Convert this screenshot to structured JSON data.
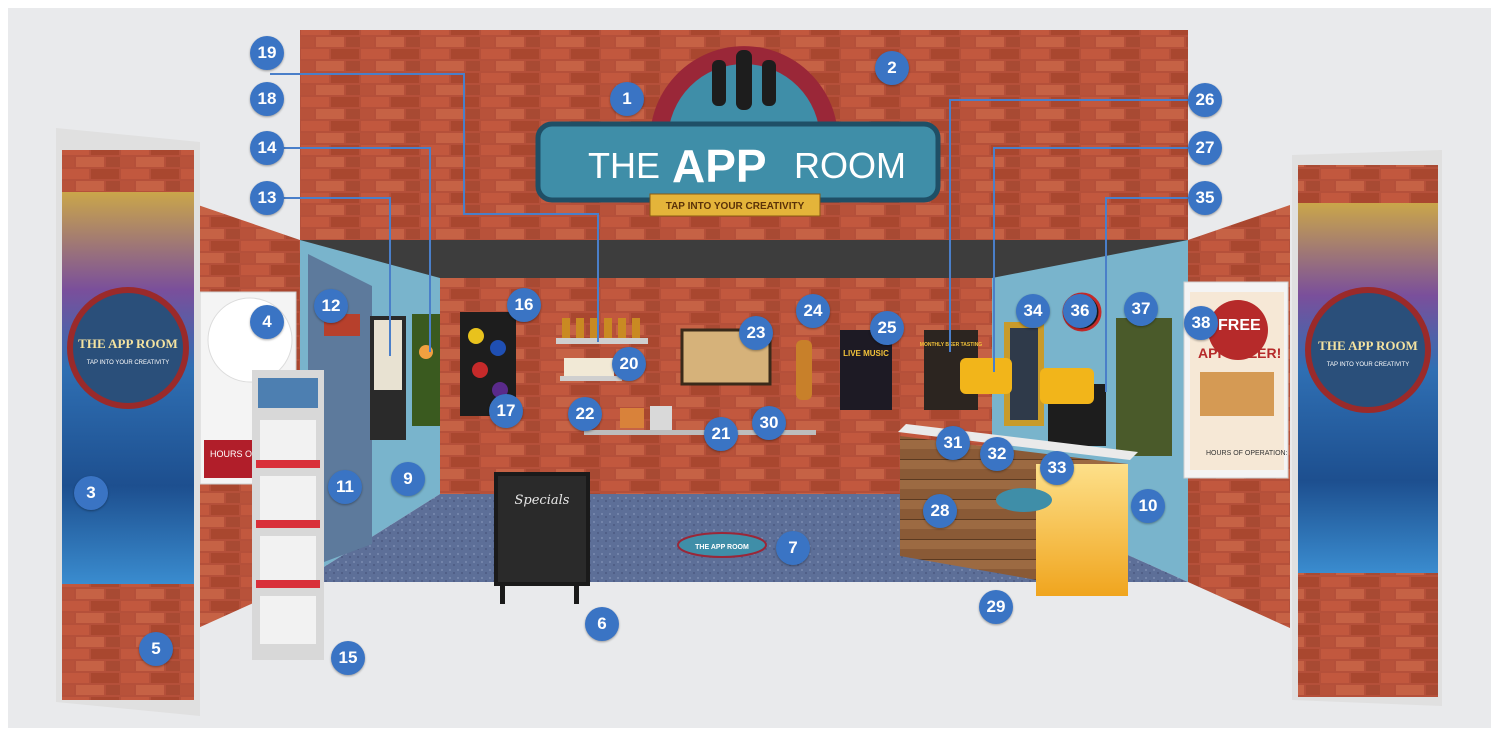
{
  "sign": {
    "the": "THE",
    "app": "APP",
    "room": "ROOM",
    "tagline": "TAP INTO YOUR CREATIVITY"
  },
  "banner": {
    "text": "THE APP ROOM",
    "sub": "TAP INTO YOUR CREATIVITY"
  },
  "small_logo": "THE APP ROOM",
  "chalkboard_title": "Specials",
  "gig_poster": "LIVE MUSIC",
  "beer_poster": "MONTHLY BEER TASTING",
  "free_poster": {
    "line1": "FREE",
    "line2": "APPETIZER!",
    "footer": "HOURS OF OPERATION:"
  },
  "left_hours": "HOURS OF OPERATION:",
  "colors": {
    "brick": "#b5503a",
    "teal_sign": "#3f8ea8",
    "marker": "#3a74c4",
    "leader": "#4a7fc9",
    "wall_blue": "#79b4cc",
    "carpet": "#5d6f98"
  },
  "markers": [
    "1",
    "2",
    "3",
    "4",
    "5",
    "6",
    "7",
    "9",
    "10",
    "11",
    "12",
    "13",
    "14",
    "15",
    "16",
    "17",
    "18",
    "19",
    "20",
    "21",
    "22",
    "23",
    "24",
    "25",
    "26",
    "27",
    "28",
    "29",
    "30",
    "31",
    "32",
    "33",
    "34",
    "35",
    "36",
    "37",
    "38"
  ]
}
